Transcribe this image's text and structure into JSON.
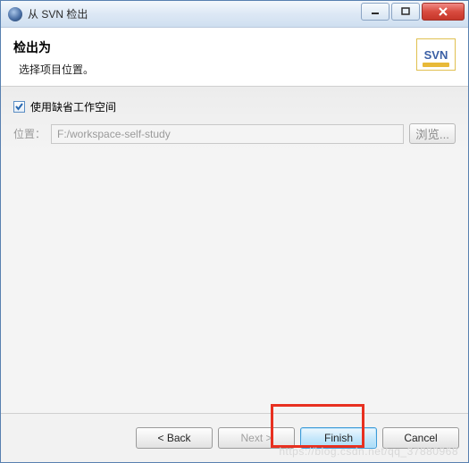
{
  "titlebar": {
    "title": "从 SVN 检出"
  },
  "header": {
    "title": "检出为",
    "subtitle": "选择项目位置。",
    "logo_text": "SVN"
  },
  "body": {
    "use_default_workspace_label": "使用缺省工作空间",
    "location_label": "位置：",
    "location_value": "F:/workspace-self-study",
    "browse_label": "浏览..."
  },
  "footer": {
    "back_label": "< Back",
    "next_label": "Next >",
    "finish_label": "Finish",
    "cancel_label": "Cancel"
  },
  "watermark": "https://blog.csdn.net/qq_37880968"
}
